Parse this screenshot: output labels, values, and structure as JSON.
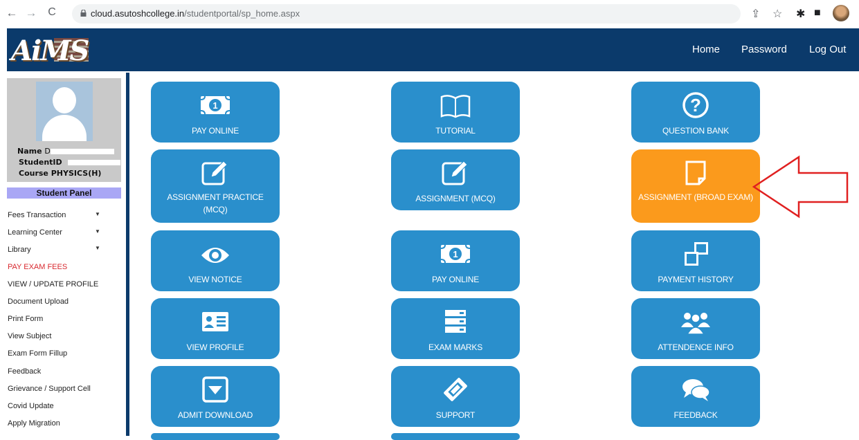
{
  "browser": {
    "url_domain": "cloud.asutoshcollege.in",
    "url_path": "/studentportal/sp_home.aspx"
  },
  "header": {
    "logo_text": "AiMS",
    "links": [
      "Home",
      "Password",
      "Log Out"
    ]
  },
  "profile": {
    "name_label": "Name",
    "name_visible": "D",
    "studentid_label": "StudentID",
    "course_label": "Course",
    "course_value": "PHYSICS(H)"
  },
  "sidebar": {
    "panel_title": "Student Panel",
    "items": [
      {
        "label": "Fees Transaction"
      },
      {
        "label": "Learning Center"
      },
      {
        "label": "Library"
      },
      {
        "label": "PAY EXAM FEES"
      },
      {
        "label": "VIEW / UPDATE PROFILE"
      },
      {
        "label": "Document Upload"
      },
      {
        "label": "Print Form"
      },
      {
        "label": "View Subject"
      },
      {
        "label": "Exam Form Fillup"
      },
      {
        "label": "Feedback"
      },
      {
        "label": "Grievance / Support Cell"
      },
      {
        "label": "Covid Update"
      },
      {
        "label": "Apply Migration"
      }
    ]
  },
  "tiles": [
    {
      "label": "PAY ONLINE",
      "icon": "money-icon"
    },
    {
      "label": "TUTORIAL",
      "icon": "book-icon"
    },
    {
      "label": "QUESTION BANK",
      "icon": "question-icon"
    },
    {
      "label": "ASSIGNMENT PRACTICE (MCQ)",
      "icon": "edit-icon"
    },
    {
      "label": "ASSIGNMENT (MCQ)",
      "icon": "edit-icon"
    },
    {
      "label": "ASSIGNMENT (BROAD EXAM)",
      "icon": "document-icon"
    },
    {
      "label": "VIEW NOTICE",
      "icon": "eye-icon"
    },
    {
      "label": "PAY ONLINE",
      "icon": "money-icon"
    },
    {
      "label": "PAYMENT HISTORY",
      "icon": "windows-icon"
    },
    {
      "label": "VIEW PROFILE",
      "icon": "id-card-icon"
    },
    {
      "label": "EXAM MARKS",
      "icon": "server-icon"
    },
    {
      "label": "ATTENDENCE INFO",
      "icon": "users-icon"
    },
    {
      "label": "ADMIT DOWNLOAD",
      "icon": "download-box-icon"
    },
    {
      "label": "SUPPORT",
      "icon": "ticket-icon"
    },
    {
      "label": "FEEDBACK",
      "icon": "comments-icon"
    }
  ],
  "colors": {
    "header_bg": "#0b3a6b",
    "tile_blue": "#2a8fcc",
    "tile_orange": "#fb9a1c",
    "panel_purple": "#a9a7f5",
    "pay_exam_red": "#d8292f",
    "arrow_red": "#e02020"
  }
}
